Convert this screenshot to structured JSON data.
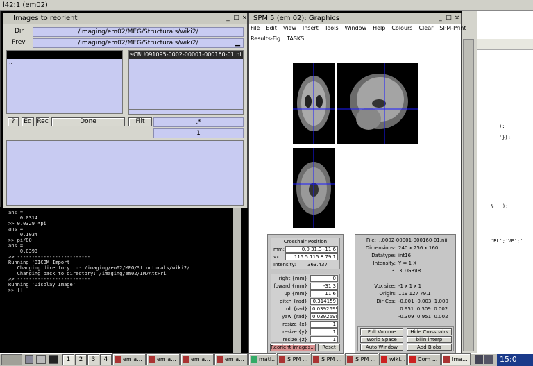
{
  "outer_title": "l42:1 (em02)",
  "images_dialog": {
    "title": "Images to reorient",
    "dir_label": "Dir",
    "dir_value": "/imaging/em02/MEG/Structurals/wiki2/",
    "prev_label": "Prev",
    "prev_value": "/imaging/em02/MEG/Structurals/wiki2/",
    "dirs_list": [
      ".."
    ],
    "files_list": [
      "sCBU091095-0002-00001-000160-01.nii"
    ],
    "help_button": "?",
    "ed_button": "Ed",
    "rec_button": "Rec",
    "done_button": "Done",
    "filt_button": "Filt",
    "filter_value": ".*",
    "count_value": "1"
  },
  "terminal": {
    "lines": [
      "ans =",
      "",
      "    0.0314",
      "",
      ">> 0.0329 *pi",
      "",
      "ans =",
      "",
      "    0.1034",
      "",
      ">> pi/80",
      "",
      "ans =",
      "",
      "    0.0393",
      "",
      ">> -------------------------",
      "Running 'DICOM Import'",
      "   Changing directory to: /imaging/em02/MEG/Structurals/wiki2/",
      "   Changing back to directory: /imaging/em02/IM7AttPri",
      ">> -------------------------",
      "Running 'Display Image'",
      ">> []"
    ]
  },
  "spm_window": {
    "title": "SPM 5 (em 02): Graphics",
    "menu": [
      "File",
      "Edit",
      "View",
      "Insert",
      "Tools",
      "Window",
      "Help",
      "Colours",
      "Clear",
      "SPM-Print"
    ],
    "menu2": [
      "Results-Fig",
      "TASKS"
    ],
    "crosshair_title": "Crosshair Position",
    "mm_label": "mm:",
    "mm_value": "0.0 31.3 -11.6",
    "vx_label": "vx:",
    "vx_value": "115.5 115.8 79.1",
    "intensity_label": "Intensity:",
    "intensity_value": "363.437",
    "params": [
      {
        "label": "right  {mm}",
        "value": "0"
      },
      {
        "label": "foward  {mm}",
        "value": "-31.3"
      },
      {
        "label": "up  {mm}",
        "value": "11.6"
      },
      {
        "label": "pitch  {rad}",
        "value": "0.314159"
      },
      {
        "label": "roll  {rad}",
        "value": "0.0392699"
      },
      {
        "label": "yaw  {rad}",
        "value": "0.0392699"
      },
      {
        "label": "resize  {x}",
        "value": "1"
      },
      {
        "label": "resize  {y}",
        "value": "1"
      },
      {
        "label": "resize  {z}",
        "value": "1"
      }
    ],
    "reorient_button": "Reorient images...",
    "reset_button": "Reset",
    "info": {
      "file_label": "File:",
      "file_value": "..0002-00001-000160-01.nii",
      "dimensions_label": "Dimensions:",
      "dimensions_value": "240 x 256 x 160",
      "datatype_label": "Datatype:",
      "datatype_value": "int16",
      "intensity_label": "Intensity:",
      "intensity_value": "Y = 1 X",
      "space": "3T 3D GR\\IR",
      "voxsize_label": "Vox size:",
      "voxsize_value": "-1 x 1 x 1",
      "origin_label": "Origin:",
      "origin_value": "119 127 79.1",
      "dircos_label": "Dir Cos:",
      "dircos_rows": [
        "-0.001 -0.003  1.000",
        " 0.951  0.309  0.002",
        "-0.309  0.951  0.002"
      ]
    },
    "buttons_row1": [
      "Full Volume",
      "Hide Crosshairs"
    ],
    "buttons_row2": [
      "World Space",
      "bilin interp"
    ],
    "buttons_row3": [
      "Auto Window",
      "Add Blobs"
    ]
  },
  "right_editor": {
    "lines": [
      ");",
      "'});",
      "",
      "",
      "% ' );",
      "",
      "'RL';'VF';'"
    ]
  },
  "taskbar": {
    "workspaces": [
      "1",
      "2",
      "3",
      "4"
    ],
    "tasks": [
      "em a...",
      "em a...",
      "em a...",
      "em a...",
      "matl...",
      "S PM ...",
      "S PM ...",
      "S PM ...",
      "wiki...",
      "Com ...",
      "Ima..."
    ],
    "clock": "15:0"
  }
}
